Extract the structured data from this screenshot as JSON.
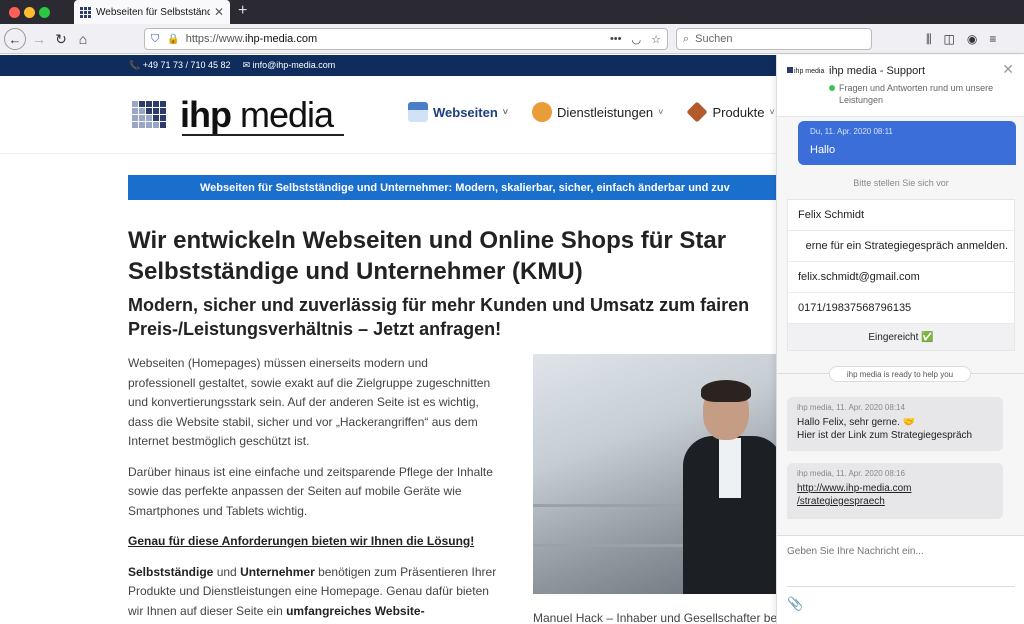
{
  "browser": {
    "tab_title": "Webseiten für Selbstständige u",
    "tab_close": "✕",
    "new_tab": "+",
    "url_prefix": "https://www.",
    "url_domain": "ihp-media.com",
    "search_placeholder": "Suchen",
    "icons": [
      "back-icon",
      "forward-icon",
      "reload-icon",
      "home-icon",
      "shield-icon",
      "lock-icon",
      "more-icon",
      "pocket-icon",
      "star-icon",
      "library-icon",
      "sidebar-icon",
      "account-icon",
      "menu-icon"
    ]
  },
  "site": {
    "phone": "+49 71 73 / 710 45 82",
    "email": "info@ihp-media.com",
    "logo_a": "ihp",
    "logo_b": " media",
    "menu": [
      {
        "label": "Webseiten",
        "caret": "˅"
      },
      {
        "label": "Dienstleistungen",
        "caret": "˅"
      },
      {
        "label": "Produkte",
        "caret": "˅"
      }
    ],
    "banner": "Webseiten für Selbstständige und Unternehmer: Modern, skalierbar, sicher, einfach änderbar und zuv",
    "h1_line1": "Wir entwickeln Webseiten und Online Shops für Star",
    "h1_line2": "Selbstständige und Unternehmer (KMU)",
    "h2": "Modern, sicher und zuverlässig für mehr Kunden und Umsatz zum fairen Preis-/Leistungsverhältnis – Jetzt anfragen!",
    "p1": "Webseiten (Homepages) müssen einerseits modern und professionell gestaltet, sowie exakt auf die Zielgruppe zugeschnitten und konvertierungsstark sein. Auf der anderen Seite ist es wichtig, dass die Website stabil, sicher und vor „Hackerangriffen“ aus dem Internet bestmöglich geschützt ist.",
    "p2": "Darüber hinaus ist eine einfache und zeitsparende Pflege der Inhalte sowie das perfekte anpassen der Seiten auf mobile Geräte wie Smartphones und Tablets wichtig.",
    "p3": "Genau für diese Anforderungen bieten wir Ihnen die Lösung!",
    "p4_b1": "Selbstständige",
    "p4_t1": " und ",
    "p4_b2": "Unternehmer",
    "p4_t2": " benötigen zum Präsentieren Ihrer Produkte und Dienstleistungen eine Homepage. Genau dafür bieten wir Ihnen auf dieser Seite ein ",
    "p4_b3": "umfangreiches Website-",
    "caption": "Manuel Hack – Inhaber und Gesellschafter bei"
  },
  "chat": {
    "logo": "ihp media",
    "title": "ihp media - Support",
    "subtitle": "Fragen und Antworten rund um unsere Leistungen",
    "close": "✕",
    "out_time": "Du, 11. Apr. 2020 08:11",
    "out_msg": "Hallo",
    "prompt": "Bitte stellen Sie sich vor",
    "form": {
      "name": "Felix Schmidt",
      "topic": "erne für ein Strategiegespräch anmelden.",
      "email": "felix.schmidt@gmail.com",
      "phone": "0171/19837568796135",
      "status": "Eingereicht ✅"
    },
    "ready": "ihp media is ready to help you",
    "in1_time": "ihp media, 11. Apr. 2020 08:14",
    "in1_line1": "Hallo Felix, sehr gerne. 🤝",
    "in1_line2": "Hier ist der Link zum Strategiegespräch",
    "in2_time": "ihp media, 11. Apr. 2020 08:16",
    "in2_link1": "http://www.ihp-media.com",
    "in2_link2": "/strategiegespraech",
    "composer_placeholder": "Geben Sie Ihre Nachricht ein..."
  }
}
